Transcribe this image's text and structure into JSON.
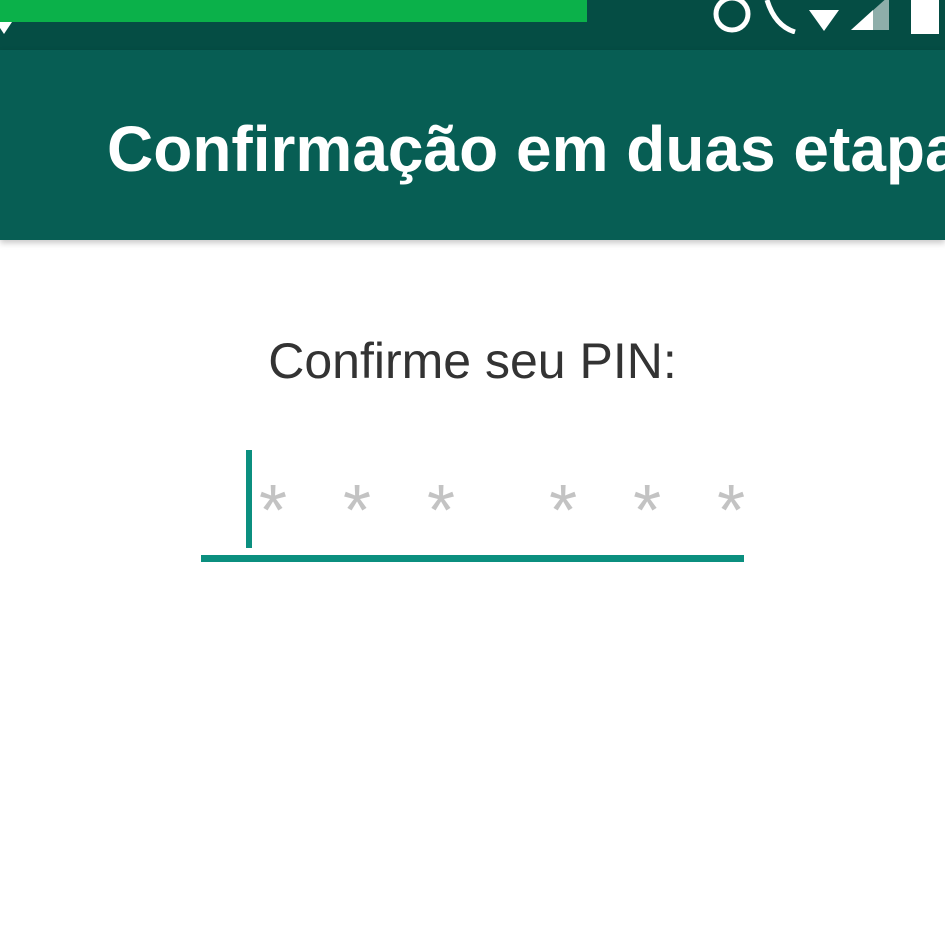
{
  "status_bar": {
    "background": "#054d44",
    "banner_color": "#0bb14a",
    "icons": [
      "signal-icon",
      "alarm-icon",
      "vibrate-icon",
      "wifi-icon",
      "cellular-icon",
      "battery-icon"
    ]
  },
  "app_bar": {
    "title": "Confirmação em duas etapa",
    "background": "#075e54"
  },
  "pin": {
    "label": "Confirme seu PIN:",
    "placeholder": "* * *  * * *",
    "accent": "#0b8f7f"
  }
}
